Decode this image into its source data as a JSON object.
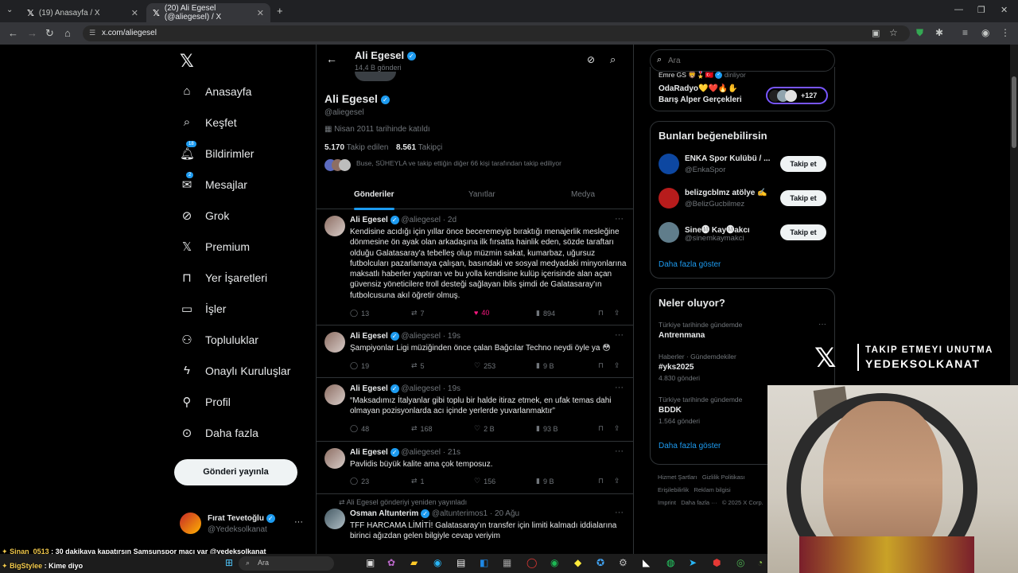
{
  "browser": {
    "tabs": [
      {
        "title": "(19) Anasayfa / X"
      },
      {
        "title": "(20) Ali Egesel (@aliegesel) / X"
      }
    ],
    "new_tab": "+",
    "url": "x.com/aliegesel"
  },
  "nav": {
    "items": [
      {
        "label": "Anasayfa"
      },
      {
        "label": "Keşfet"
      },
      {
        "label": "Bildirimler",
        "badge": "18"
      },
      {
        "label": "Mesajlar",
        "badge": "2"
      },
      {
        "label": "Grok"
      },
      {
        "label": "Premium"
      },
      {
        "label": "Yer İşaretleri"
      },
      {
        "label": "İşler"
      },
      {
        "label": "Topluluklar"
      },
      {
        "label": "Onaylı Kuruluşlar"
      },
      {
        "label": "Profil"
      },
      {
        "label": "Daha fazla"
      }
    ],
    "post_button": "Gönderi yayınla",
    "account": {
      "name": "Fırat Tevetoğlu",
      "handle": "@Yedeksolkanat",
      "more": "···"
    }
  },
  "profile": {
    "header_name": "Ali Egesel",
    "post_count": "14,4 B gönderi",
    "name": "Ali Egesel",
    "handle": "@aliegesel",
    "joined": "Nisan 2011 tarihinde katıldı",
    "following_count": "5.170",
    "following_label": "Takip edilen",
    "followers_count": "8.561",
    "followers_label": "Takipçi",
    "followed_by": "Buse, SÜHEYLA ve takip ettiğin diğer 66 kişi tarafından takip ediliyor",
    "tabs": [
      "Gönderiler",
      "Yanıtlar",
      "Medya"
    ]
  },
  "tweets": [
    {
      "name": "Ali Egesel",
      "handle": "@aliegesel",
      "time": "· 2d",
      "text": "Kendisine acıdığı için yıllar önce beceremeyip bıraktığı menajerlik mesleğine dönmesine ön ayak olan arkadaşına ilk fırsatta hainlik eden, sözde taraftarı olduğu Galatasaray'a tebelleş olup müzmin sakat, kumarbaz, uğursuz futbolcuları pazarlamaya çalışan, basındaki ve sosyal medyadaki minyonlarına maksatlı haberler yaptıran ve bu yolla kendisine kulüp içerisinde alan açan güvensiz yöneticilere troll desteği sağlayan iblis şimdi de Galatasaray'ın futbolcusuna akıl öğretir olmuş.",
      "replies": "13",
      "reposts": "7",
      "likes": "40",
      "views": "894"
    },
    {
      "name": "Ali Egesel",
      "handle": "@aliegesel",
      "time": "· 19s",
      "text": "Şampiyonlar Ligi müziğinden önce çalan Bağcılar Techno neydi öyle ya 😳",
      "replies": "19",
      "reposts": "5",
      "likes": "253",
      "views": "9 B"
    },
    {
      "name": "Ali Egesel",
      "handle": "@aliegesel",
      "time": "· 19s",
      "text": "“Maksadımız İtalyanlar gibi toplu bir halde itiraz etmek, en ufak temas dahi olmayan pozisyonlarda acı içinde yerlerde yuvarlanmaktır”",
      "replies": "48",
      "reposts": "168",
      "likes": "2 B",
      "views": "93 B"
    },
    {
      "name": "Ali Egesel",
      "handle": "@aliegesel",
      "time": "· 21s",
      "text": "Pavlidis büyük kalite ama çok temposuz.",
      "replies": "23",
      "reposts": "1",
      "likes": "156",
      "views": "9 B"
    },
    {
      "repost_note": "Ali Egesel gönderiyi yeniden yayınladı",
      "name": "Osman Altunterim",
      "handle": "@altunterimos1",
      "time": "· 20 Ağu",
      "text": "TFF HARCAMA LİMİTİ! Galatasaray'ın transfer için limiti kalmadı iddialarına birinci ağızdan gelen bilgiyle cevap veriyim"
    }
  ],
  "right": {
    "search_placeholder": "Ara",
    "space_host": "Emre GS 🦁🎖️🇹🇷",
    "space_status": "dinliyor",
    "space_title1": "OdaRadyo💛❤️🔥✋",
    "space_title2": "Barış Alper Gerçekleri",
    "space_more": "+127",
    "suggest_title": "Bunları beğenebilirsin",
    "suggestions": [
      {
        "name": "ENKA Spor Kulübü / ...",
        "handle": "@EnkaSpor",
        "button": "Takip et"
      },
      {
        "name": "belizgcblmz atölye ✍️",
        "handle": "@BelizGucbilmez",
        "button": "Takip et"
      },
      {
        "name": "Sine🅜 Kay🅜akcı",
        "handle": "@sinemkaymakci",
        "button": "Takip et"
      }
    ],
    "show_more": "Daha fazla göster",
    "trends_title": "Neler oluyor?",
    "trends": [
      {
        "context": "Türkiye tarihinde gündemde",
        "name": "Antrenmana",
        "count": ""
      },
      {
        "context": "Haberler · Gündemdekiler",
        "name": "#yks2025",
        "count": "4.830 gönderi"
      },
      {
        "context": "Türkiye tarihinde gündemde",
        "name": "BDDK",
        "count": "1.564 gönderi"
      }
    ],
    "trends_more": "Daha fazla göster",
    "footer": [
      "Hizmet Şartları",
      "Gizlilik Politikası",
      "Imprint",
      "Erişilebilirlik",
      "Reklam bilgisi",
      "Daha fazla ···",
      "© 2025 X Corp."
    ]
  },
  "overlay": {
    "line1": "TAKIP ETMEYI UNUTMA",
    "line2": "YEDEKSOLKANAT"
  },
  "chat": [
    {
      "user": "Sinan_0513",
      "text": " : 30 dakikaya kapatırsın Samsunspor maçı var @yedeksolkanat"
    },
    {
      "user": "BigStylee",
      "text": " : Kime diyo"
    }
  ],
  "taskbar": {
    "search": "Ara"
  },
  "colors": {
    "accent": "#1d9bf0",
    "like": "#f91880",
    "bg": "#000000",
    "border": "#2f3336"
  }
}
